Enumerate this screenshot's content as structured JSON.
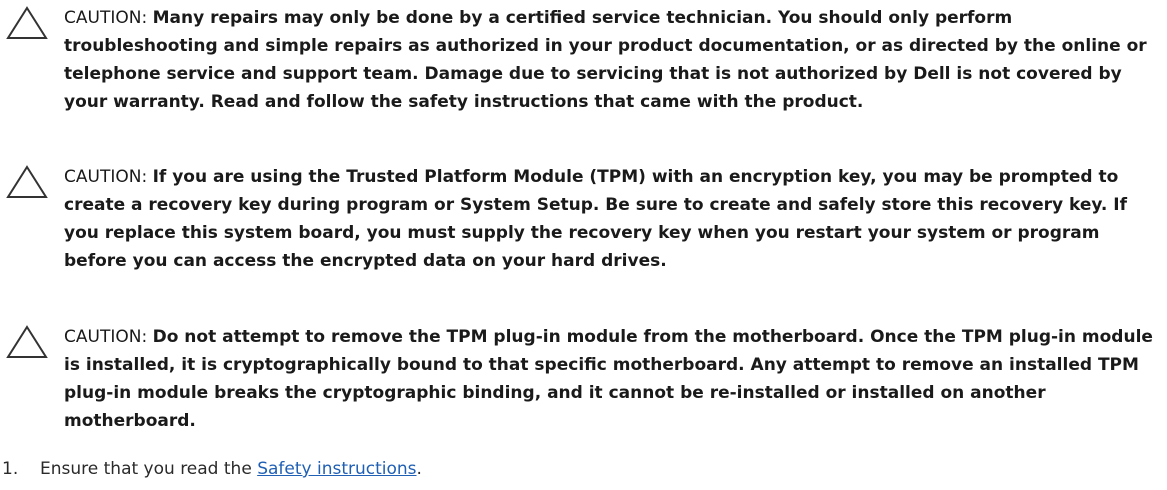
{
  "cautions": [
    {
      "label": "CAUTION: ",
      "text": "Many repairs may only be done by a certified service technician. You should only perform troubleshooting and simple repairs as authorized in your product documentation, or as directed by the online or telephone service and support team. Damage due to servicing that is not authorized by Dell is not covered by your warranty. Read and follow the safety instructions that came with the product."
    },
    {
      "label": "CAUTION: ",
      "text": "If you are using the Trusted Platform Module (TPM) with an encryption key, you may be prompted to create a recovery key during program or System Setup. Be sure to create and safely store this recovery key. If you replace this system board, you must supply the recovery key when you restart your system or program before you can access the encrypted data on your hard drives."
    },
    {
      "label": "CAUTION: ",
      "text": "Do not attempt to remove the TPM plug-in module from the motherboard. Once the TPM plug-in module is installed, it is cryptographically bound to that specific motherboard. Any attempt to remove an installed TPM plug-in module breaks the cryptographic binding, and it cannot be re-installed or installed on another motherboard."
    }
  ],
  "steps": [
    {
      "number": "1.",
      "prefix": "Ensure that you read the ",
      "link_text": "Safety instructions",
      "suffix": "."
    }
  ],
  "colors": {
    "link": "#1f5fb4",
    "text": "#1a1a1a"
  },
  "icons": {
    "caution": "caution-triangle-icon"
  }
}
